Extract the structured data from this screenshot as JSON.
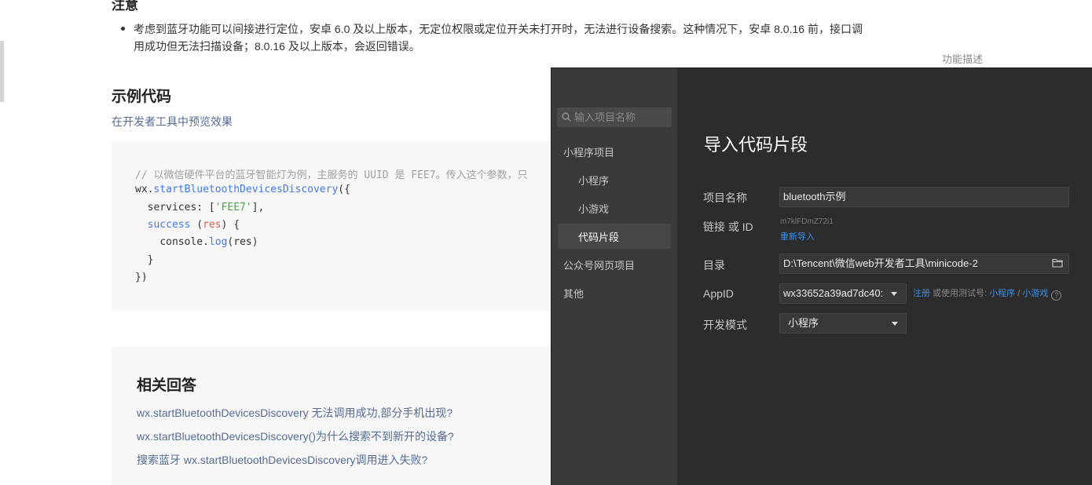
{
  "doc": {
    "notice_heading": "注意",
    "notice_text": "考虑到蓝牙功能可以间接进行定位，安卓 6.0 及以上版本，无定位权限或定位开关未打开时，无法进行设备搜索。这种情况下，安卓 8.0.16 前，接口调用成功但无法扫描设备；8.0.16 及以上版本，会返回错误。",
    "feature_desc": "功能描述",
    "section_title": "示例代码",
    "preview_link": "在开发者工具中预览效果",
    "code": {
      "comment": "// 以微信硬件平台的蓝牙智能灯为例，主服务的 UUID 是 FEE7。传入这个参数，只",
      "call_obj": "wx.",
      "call_fn": "startBluetoothDevicesDiscovery",
      "call_open": "({",
      "services_key": "services: [",
      "services_val": "'FEE7'",
      "services_close": "],",
      "success_key": "success",
      "success_param": "res",
      "console_obj": "console.",
      "console_fn": "log",
      "console_arg": "(res)",
      "brace_close": "}",
      "call_close": "})"
    },
    "answers_title": "相关回答",
    "answers": [
      "wx.startBluetoothDevicesDiscovery 无法调用成功,部分手机出现?",
      "wx.startBluetoothDevicesDiscovery()为什么搜索不到新开的设备?",
      "搜索蓝牙 wx.startBluetoothDevicesDiscovery调用进入失败?"
    ]
  },
  "dialog": {
    "search_placeholder": "输入项目名称",
    "sidebar": {
      "miniprogram_projects": "小程序项目",
      "miniprogram": "小程序",
      "minigame": "小游戏",
      "code_snippet": "代码片段",
      "official_web": "公众号网页项目",
      "other": "其他"
    },
    "title": "导入代码片段",
    "fields": {
      "name_label": "项目名称",
      "name_value": "bluetooth示例",
      "link_label": "链接 或 ID",
      "link_value": "m7klFDmZ72i1",
      "reimport": "重新导入",
      "dir_label": "目录",
      "dir_value": "D:\\Tencent\\微信web开发者工具\\minicode-2",
      "appid_label": "AppID",
      "appid_value": "wx33652a39ad7dc40:",
      "register": "注册",
      "or_test": "或使用测试号:",
      "test_mini": "小程序",
      "slash": "/",
      "test_game": "小游戏",
      "mode_label": "开发模式",
      "mode_value": "小程序"
    }
  }
}
